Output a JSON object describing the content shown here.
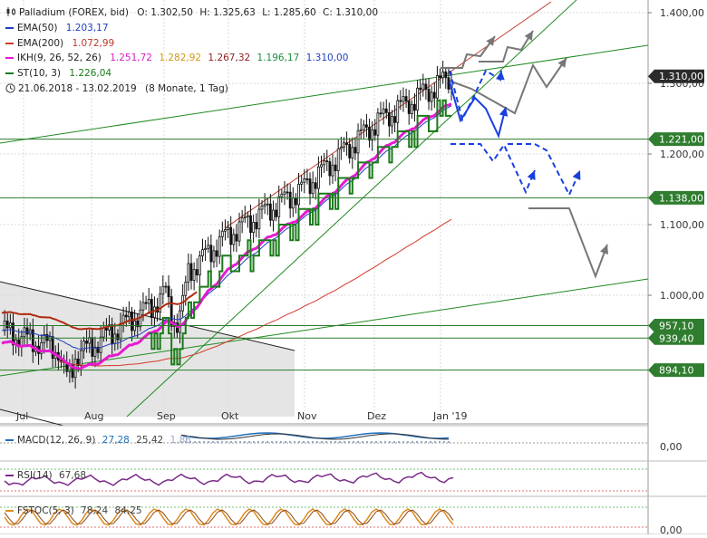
{
  "chart_data": {
    "type": "line",
    "instrument": "Palladium (FOREX, bid)",
    "ohlc": {
      "o": "O: 1.302,50",
      "h": "H: 1.325,63",
      "l": "L: 1.285,60",
      "c": "C: 1.310,00"
    },
    "indicators": [
      {
        "name": "EMA(50)",
        "values": [
          "1.203,17"
        ],
        "color": "#1f3fbf"
      },
      {
        "name": "EMA(200)",
        "values": [
          "1.072,99"
        ],
        "color": "#d43a2a"
      },
      {
        "name": "IKH(9, 26, 52, 26)",
        "values": [
          "1.251,72",
          "1.282,92",
          "1.267,32",
          "1.196,17",
          "1.310,00"
        ],
        "value_colors": [
          "#d61fc4",
          "#d19a1a",
          "#8e1f1f",
          "#1a8f3a",
          "#1f3fbf"
        ],
        "color": "#e619d0"
      },
      {
        "name": "ST(10, 3)",
        "values": [
          "1.226,04"
        ],
        "color": "#1a7a1a"
      }
    ],
    "period": "21.06.2018 - 13.02.2019",
    "period_detail": "(8 Monate, 1 Tag)",
    "x_labels": [
      "Jul",
      "Aug",
      "Sep",
      "Okt",
      "Nov",
      "Dez",
      "Jan '19"
    ],
    "y_ticks": [
      "1.400,00",
      "1.300,00",
      "1.200,00",
      "1.100,00",
      "1.000,00"
    ],
    "ylim": [
      870,
      1430
    ],
    "price_flags": [
      {
        "value": 1310.0,
        "label": "1.310,00",
        "style": "dark"
      },
      {
        "value": 1221.0,
        "label": "1.221,00",
        "style": "green"
      },
      {
        "value": 1138.0,
        "label": "1.138,00",
        "style": "green"
      },
      {
        "value": 957.1,
        "label": "957,10",
        "style": "green"
      },
      {
        "value": 939.4,
        "label": "939,40",
        "style": "green"
      },
      {
        "value": 894.1,
        "label": "894,10",
        "style": "green"
      }
    ],
    "horizontal_levels": [
      1221.0,
      1138.0,
      957.1,
      939.4,
      894.1
    ],
    "close_series": [
      {
        "month": "Jul",
        "close": 950
      },
      {
        "month": "Aug",
        "close": 915
      },
      {
        "month": "Sep",
        "close": 985
      },
      {
        "month": "Okt",
        "close": 1085
      },
      {
        "month": "Nov",
        "close": 1150
      },
      {
        "month": "Dez",
        "close": 1245
      },
      {
        "month": "Jan '19",
        "close": 1310
      }
    ],
    "subpanels": [
      {
        "name": "MACD(12, 26, 9)",
        "values": [
          "27,28",
          "25,42",
          "1,86"
        ],
        "value_colors": [
          "#1f6fbf",
          "#444444",
          "#9aa9c9"
        ],
        "tick": "0,00"
      },
      {
        "name": "RSI(14)",
        "values": [
          "67,68"
        ],
        "value_colors": [
          "#444444"
        ]
      },
      {
        "name": "FSTOC(5, 3)",
        "values": [
          "78,24",
          "84,25"
        ],
        "value_colors": [
          "#444444",
          "#444444"
        ],
        "tick": "0,00"
      }
    ]
  },
  "colors": {
    "grid": "#d9d9d9",
    "green_line": "#1f8a1f",
    "blue_scenario": "#1a3fe0",
    "grey_scenario": "#777777"
  },
  "icons": {
    "chart": "candlestick-icon",
    "clock": "clock-icon"
  }
}
